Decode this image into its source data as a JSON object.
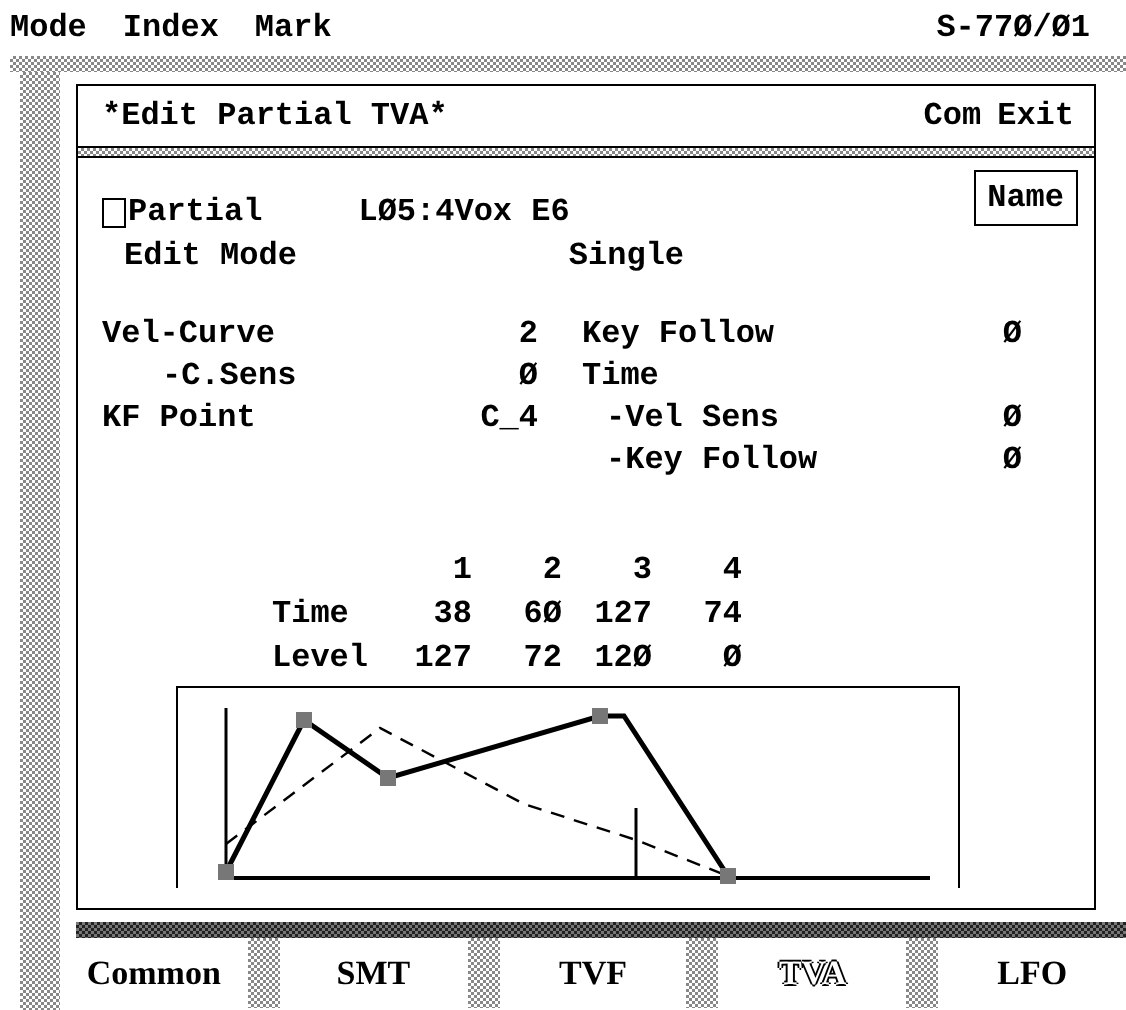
{
  "menu": [
    {
      "label": "Mode"
    },
    {
      "label": "Index"
    },
    {
      "label": "Mark"
    }
  ],
  "model": "S-77Ø/Ø1",
  "dialog": {
    "title": "*Edit Partial TVA*",
    "actions": [
      "Com",
      "Exit"
    ],
    "name_button": "Name",
    "partial": {
      "checked": false,
      "label": "Partial",
      "value": "LØ5:4Vox E6"
    },
    "edit_mode": {
      "label": "Edit Mode",
      "value": "Single"
    },
    "left_params": [
      {
        "kind": "param",
        "label": "Vel-Curve",
        "value": "2"
      },
      {
        "kind": "sub",
        "label": "-C.Sens",
        "value": "Ø"
      },
      {
        "kind": "param",
        "label": "KF Point",
        "value": "C_4"
      }
    ],
    "right_params": [
      {
        "kind": "param",
        "label": "Key Follow",
        "value": "Ø"
      },
      {
        "kind": "heading",
        "label": "Time"
      },
      {
        "kind": "sub",
        "label": "-Vel Sens",
        "value": "Ø"
      },
      {
        "kind": "sub",
        "label": "-Key Follow",
        "value": "Ø"
      }
    ],
    "envelope": {
      "columns": [
        "1",
        "2",
        "3",
        "4"
      ],
      "rows": [
        {
          "label": "Time",
          "values": [
            "38",
            "6Ø",
            "127",
            "74"
          ]
        },
        {
          "label": "Level",
          "values": [
            "127",
            "72",
            "12Ø",
            "Ø"
          ]
        }
      ]
    }
  },
  "tabs": [
    {
      "label": "Common",
      "selected": false
    },
    {
      "label": "SMT",
      "selected": false
    },
    {
      "label": "TVF",
      "selected": false
    },
    {
      "label": "TVA",
      "selected": true
    },
    {
      "label": "LFO",
      "selected": false
    }
  ]
}
